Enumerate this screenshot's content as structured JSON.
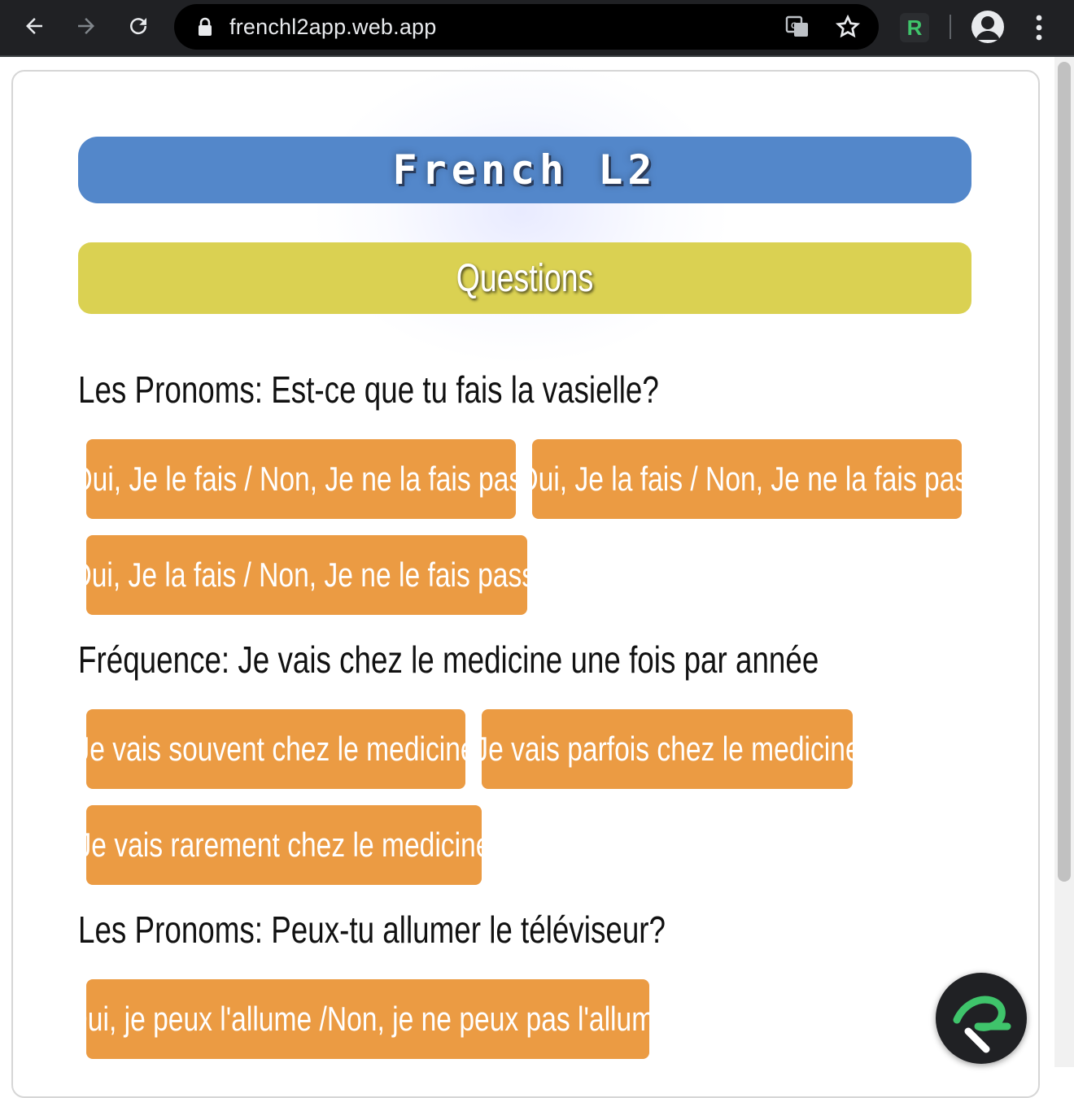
{
  "browser": {
    "url": "frenchl2app.web.app",
    "extension_label": "R"
  },
  "app": {
    "title": "French L2",
    "section": "Questions"
  },
  "questions": [
    {
      "text": "Les Pronoms: Est-ce que tu fais la vasielle?",
      "answers": [
        "Oui, Je le fais / Non, Je ne la fais pas.",
        "Oui, Je la fais / Non, Je ne la fais pas.",
        "Oui, Je la fais / Non, Je ne le fais pass."
      ]
    },
    {
      "text": "Fréquence: Je vais chez le medicine une fois par année",
      "answers": [
        "Je vais souvent chez le medicine",
        "Je vais parfois chez le medicine",
        "Je vais rarement chez le medicine"
      ]
    },
    {
      "text": "Les Pronoms: Peux-tu allumer le téléviseur?",
      "answers": [
        "Oui, je peux l'allume /Non, je ne peux pas l'allume"
      ]
    }
  ],
  "colors": {
    "title_bar": "#5387ca",
    "section_bar": "#dad152",
    "answer_button": "#eb9b43",
    "chrome": "#202124"
  }
}
